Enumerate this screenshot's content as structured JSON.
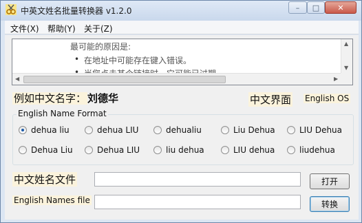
{
  "window": {
    "title": "中英文姓名批量转换器 v1.2.0",
    "icon": "scissors-app-icon",
    "controls": {
      "minimize": "–",
      "maximize": "□",
      "close": "✕"
    }
  },
  "menu": [
    "文件(X)",
    "帮助(Y)",
    "关于(Z)"
  ],
  "browser": {
    "line1": "最可能的原因是:",
    "bullets": [
      "在地址中可能存在键入错误。",
      "当您点击某个链接时，它可能已过期。"
    ]
  },
  "example": {
    "label": "例如中文名字：",
    "name": "刘德华"
  },
  "ui_language_label": "中文界面",
  "os_label": "English OS",
  "format_group": {
    "title": "English Name Format",
    "options": [
      {
        "label": "dehua liu",
        "selected": true
      },
      {
        "label": "dehua LIU",
        "selected": false
      },
      {
        "label": "dehualiu",
        "selected": false
      },
      {
        "label": "Liu Dehua",
        "selected": false
      },
      {
        "label": "LIU Dehua",
        "selected": false
      },
      {
        "label": "Dehua Liu",
        "selected": false
      },
      {
        "label": "Dehua LIU",
        "selected": false
      },
      {
        "label": "liu dehua",
        "selected": false
      },
      {
        "label": "LIU dehua",
        "selected": false
      },
      {
        "label": "liudehua",
        "selected": false
      }
    ]
  },
  "chinese_file": {
    "label": "中文姓名文件",
    "value": "",
    "button": "打开"
  },
  "english_file": {
    "label": "English Names file",
    "value": "",
    "button": "转换"
  }
}
